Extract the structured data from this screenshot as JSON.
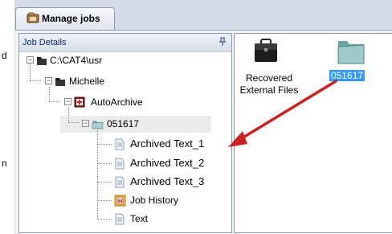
{
  "margin_fragments": [
    "d",
    "n"
  ],
  "tab": {
    "title": "Manage jobs"
  },
  "left_panel": {
    "title": "Job Details"
  },
  "tree": [
    {
      "label": "C:\\CAT4\\usr"
    },
    {
      "label": "Michelle"
    },
    {
      "label": "AutoArchive"
    },
    {
      "label": "051617"
    },
    {
      "label": "Archived Text_1"
    },
    {
      "label": "Archived Text_2"
    },
    {
      "label": "Archived Text_3"
    },
    {
      "label": "Job History"
    },
    {
      "label": "Text"
    }
  ],
  "right_panel": {
    "items": [
      {
        "label_line1": "Recovered",
        "label_line2": "External Files",
        "icon": "briefcase-icon"
      },
      {
        "label_line1": "051617",
        "label_line2": "",
        "icon": "job-folder-icon",
        "selected": true
      }
    ]
  },
  "colors": {
    "selection": "#3399ff",
    "arrow": "#cc2222",
    "frame_border": "#8e9bb5"
  }
}
